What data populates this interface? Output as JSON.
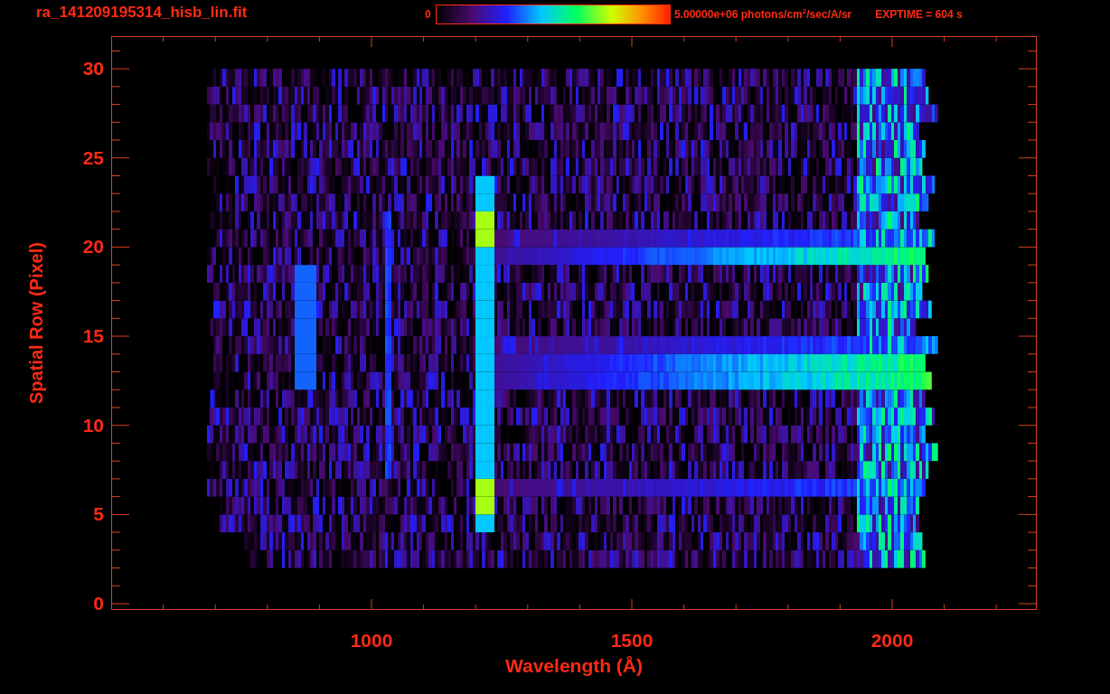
{
  "title": "ra_141209195314_hisb_lin.fit",
  "colorbar": {
    "min_label": "0",
    "max_label": "5.00000e+06 photons/cm$^{2}$/sec/A/sr"
  },
  "exposure": "EXPTIME = 604 s",
  "plot": {
    "xlabel": "Wavelength (Å)",
    "ylabel": "Spatial Row (Pixel)",
    "xticks": [
      "1000",
      "1500",
      "2000"
    ],
    "yticks": [
      "30",
      "25",
      "20",
      "15",
      "10",
      "5",
      "0"
    ]
  }
}
